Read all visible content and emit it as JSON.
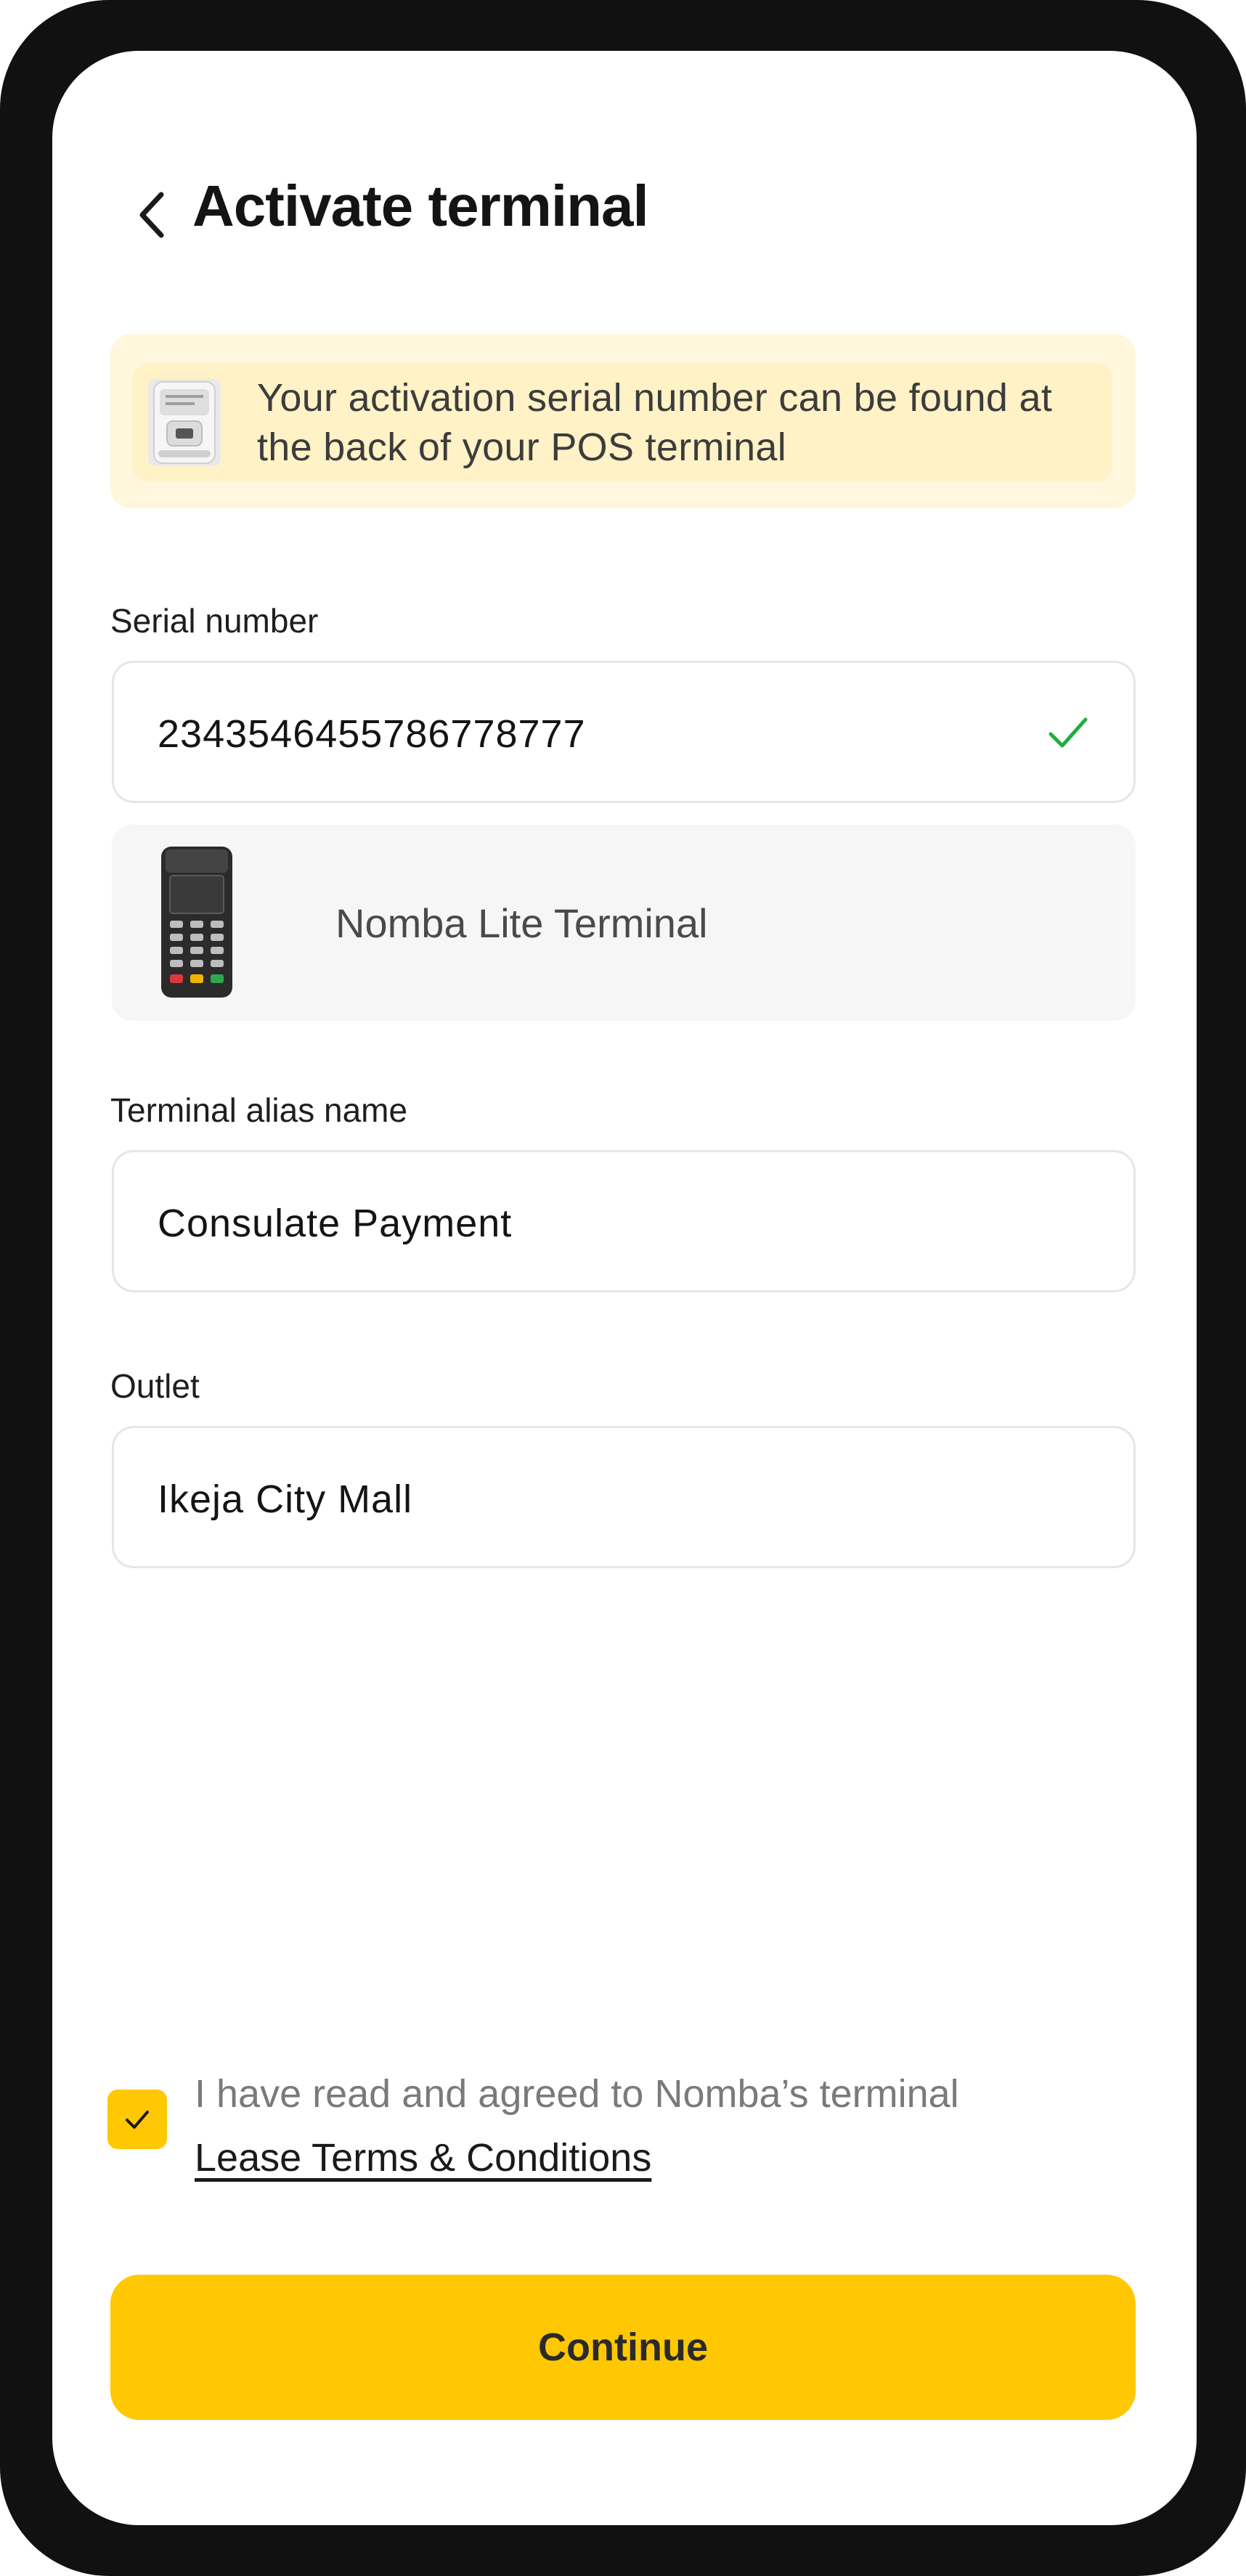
{
  "header": {
    "title": "Activate terminal",
    "back_icon": "chevron-left-icon"
  },
  "info_banner": {
    "text": "Your activation serial number can be found at the back of your POS terminal",
    "icon": "pos-device-back-image"
  },
  "serial_field": {
    "label": "Serial number",
    "value": "2343546455786778777",
    "status_icon": "check-icon",
    "status_color": "#1fae3c"
  },
  "terminal_preview": {
    "name": "Nomba Lite Terminal",
    "icon": "pos-terminal-image"
  },
  "alias_field": {
    "label": "Terminal alias name",
    "value": "Consulate Payment"
  },
  "outlet_field": {
    "label": "Outlet",
    "value": "Ikeja City Mall"
  },
  "agreement": {
    "checked": true,
    "text": "I have read and agreed to Nomba’s terminal",
    "link_text": "Lease Terms & Conditions"
  },
  "footer": {
    "continue_label": "Continue"
  },
  "colors": {
    "accent": "#ffc802",
    "banner_background": "#fff7dd",
    "card_background": "#f6f6f6",
    "text_primary": "#141414",
    "frame": "#111111"
  }
}
